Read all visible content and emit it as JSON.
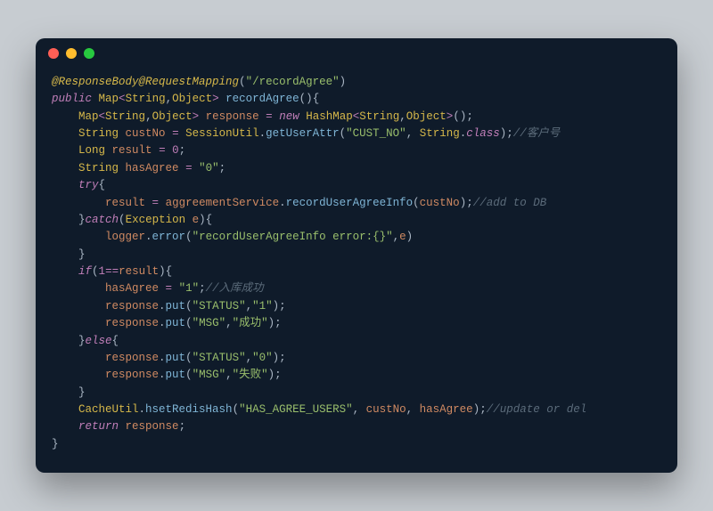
{
  "window": {
    "dots": {
      "red": "#ff5f56",
      "yellow": "#ffbd2e",
      "green": "#27c93f"
    }
  },
  "code": {
    "annotation1": "@ResponseBody",
    "annotation2": "@RequestMapping",
    "mappingPath": "\"/recordAgree\"",
    "kw_public": "public",
    "typ_Map": "Map",
    "typ_String": "String",
    "typ_Object": "Object",
    "typ_Long": "Long",
    "typ_HashMap": "HashMap",
    "typ_Exception": "Exception",
    "methodName": "recordAgree",
    "var_response": "response",
    "var_custNo": "custNo",
    "var_result": "result",
    "var_hasAgree": "hasAgree",
    "var_e": "e",
    "var_logger": "logger",
    "var_aggreementService": "aggreementService",
    "var_CacheUtil": "CacheUtil",
    "var_SessionUtil": "SessionUtil",
    "kw_new": "new",
    "kw_try": "try",
    "kw_catch": "catch",
    "kw_if": "if",
    "kw_else": "else",
    "kw_return": "return",
    "kw_class": "class",
    "mtd_getUserAttr": "getUserAttr",
    "mtd_recordUserAgreeInfo": "recordUserAgreeInfo",
    "mtd_error": "error",
    "mtd_put": "put",
    "mtd_hsetRedisHash": "hsetRedisHash",
    "str_CUST_NO": "\"CUST_NO\"",
    "str_0": "\"0\"",
    "str_1": "\"1\"",
    "str_errorMsg": "\"recordUserAgreeInfo error:{}\"",
    "str_STATUS": "\"STATUS\"",
    "str_MSG": "\"MSG\"",
    "str_success": "\"成功\"",
    "str_fail": "\"失败\"",
    "str_HAS_AGREE_USERS": "\"HAS_AGREE_USERS\"",
    "num_0": "0",
    "num_1": "1",
    "cmt_custNo": "//客户号",
    "cmt_addDb": "//add to DB",
    "cmt_inDb": "//入库成功",
    "cmt_update": "//update or del",
    "op_eq": "=",
    "op_eqeq": "==",
    "pun_lparen": "(",
    "pun_rparen": ")",
    "pun_lbrace": "{",
    "pun_rbrace": "}",
    "pun_semi": ";",
    "pun_comma": ", ",
    "pun_comma2": ",",
    "pun_dot": ".",
    "gen_lt": "<",
    "gen_gt": ">"
  }
}
